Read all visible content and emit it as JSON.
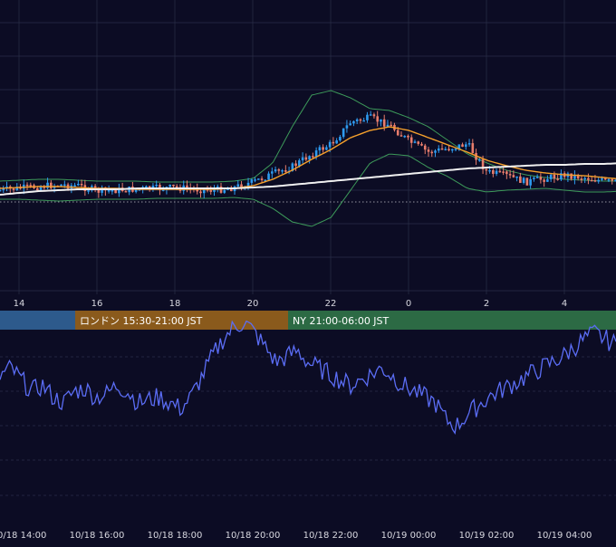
{
  "colors": {
    "background": "#0c0c24",
    "grid": "#2a2e48",
    "up_candle": "#2e9bf0",
    "down_candle": "#e87d6c",
    "ma_orange": "#f5a02c",
    "ma_white": "#f0f0f0",
    "bollinger": "#3d9a5a",
    "rsi_line": "#5b6df5",
    "tick_text": "#d8d8e0",
    "session_tokyo": "#2d5a8c",
    "session_london": "#8a5a1c",
    "session_ny": "#2c6a44"
  },
  "sessions": [
    {
      "label": "",
      "color": "#2d5a8c"
    },
    {
      "label": "ロンドン 15:30-21:00 JST",
      "color": "#8a5a1c"
    },
    {
      "label": "NY 21:00-06:00 JST",
      "color": "#2c6a44"
    }
  ],
  "chart_data": [
    {
      "type": "line",
      "title": "",
      "x_tick_labels": [
        "14",
        "16",
        "18",
        "20",
        "22",
        "0",
        "2",
        "4"
      ],
      "series": [
        {
          "kind": "candlestick",
          "hours_from_14": [
            0,
            0.5,
            1,
            1.5,
            2,
            2.5,
            3,
            3.5,
            4,
            4.5,
            5,
            5.5,
            6,
            6.5,
            7,
            7.5,
            8,
            8.5,
            9,
            9.5,
            10,
            10.5,
            11,
            11.5,
            12,
            12.5,
            13,
            13.5,
            14,
            14.5,
            15,
            15.5,
            16,
            16.5
          ],
          "close": [
            150,
            148,
            146,
            144,
            145,
            151,
            150,
            149,
            148,
            147,
            149,
            150,
            147,
            141,
            132,
            124,
            110,
            99,
            75,
            70,
            78,
            96,
            108,
            104,
            99,
            130,
            134,
            141,
            137,
            133,
            136,
            140,
            142,
            144
          ]
        },
        {
          "kind": "ma_short",
          "close": [
            148,
            147,
            146,
            146,
            147,
            148,
            148,
            149,
            149,
            149,
            149,
            149,
            148,
            145,
            138,
            128,
            116,
            105,
            92,
            84,
            80,
            84,
            92,
            100,
            108,
            117,
            123,
            128,
            131,
            133,
            134,
            136,
            138,
            140
          ]
        },
        {
          "kind": "ma_long",
          "close": [
            155,
            153,
            151,
            150,
            149,
            149,
            149,
            148,
            148,
            148,
            148,
            148,
            148,
            147,
            146,
            144,
            142,
            140,
            138,
            136,
            134,
            132,
            130,
            128,
            126,
            125,
            124,
            123,
            122,
            122,
            121,
            121,
            120,
            120
          ]
        },
        {
          "kind": "bb_upper",
          "close": [
            140,
            139,
            138,
            138,
            139,
            140,
            140,
            140,
            141,
            141,
            141,
            141,
            140,
            137,
            120,
            80,
            45,
            40,
            48,
            60,
            62,
            70,
            80,
            95,
            110,
            120,
            128,
            133,
            136,
            138,
            139,
            140,
            140,
            141
          ]
        },
        {
          "kind": "bb_lower",
          "close": [
            160,
            160,
            161,
            162,
            161,
            160,
            160,
            160,
            159,
            159,
            159,
            159,
            158,
            160,
            170,
            185,
            190,
            180,
            150,
            120,
            110,
            112,
            125,
            135,
            148,
            152,
            150,
            149,
            148,
            150,
            152,
            152,
            151,
            150
          ]
        }
      ]
    },
    {
      "type": "line",
      "title": "",
      "x_tick_labels": [
        "10/18 14:00",
        "10/18 16:00",
        "10/18 18:00",
        "10/18 20:00",
        "10/18 22:00",
        "10/19 00:00",
        "10/19 02:00",
        "10/19 04:00"
      ],
      "series": [
        {
          "kind": "oscillator",
          "values": [
            45,
            48,
            44,
            40,
            42,
            38,
            36,
            40,
            41,
            38,
            39,
            42,
            40,
            36,
            37,
            38,
            36,
            34,
            38,
            45,
            52,
            58,
            62,
            64,
            60,
            55,
            50,
            52,
            54,
            50,
            48,
            46,
            44,
            42,
            44,
            46,
            48,
            45,
            42,
            40,
            38,
            36,
            30,
            28,
            32,
            35,
            38,
            40,
            42,
            44,
            46,
            48,
            50,
            52,
            55,
            58,
            60,
            58,
            56
          ]
        }
      ]
    }
  ]
}
